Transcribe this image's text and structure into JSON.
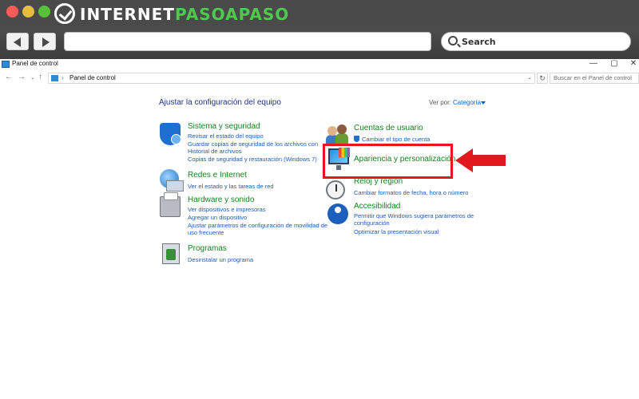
{
  "site": {
    "logo_text": "INTERNET",
    "logo_accent": "PASOAPASO"
  },
  "browser": {
    "search_placeholder": "Search"
  },
  "window": {
    "title": "Panel de control",
    "minimize": "—",
    "maximize": "▢",
    "close": "✕"
  },
  "address": {
    "path": "Panel de control",
    "search_placeholder": "Buscar en el Panel de control"
  },
  "main": {
    "heading": "Ajustar la configuración del equipo",
    "view_by_label": "Ver por:",
    "view_by_value": "Categoría"
  },
  "categories": {
    "system": {
      "title": "Sistema y seguridad",
      "links": [
        "Revisar el estado del equipo",
        "Guardar copias de seguridad de los archivos con",
        "Historial de archivos",
        "Copias de seguridad y restauración (Windows 7)"
      ]
    },
    "network": {
      "title": "Redes e Internet",
      "links": [
        "Ver el estado y las tareas de red"
      ]
    },
    "hardware": {
      "title": "Hardware y sonido",
      "links": [
        "Ver dispositivos e impresoras",
        "Agregar un dispositivo",
        "Ajustar parámetros de configuración de movilidad de",
        "uso frecuente"
      ]
    },
    "programs": {
      "title": "Programas",
      "links": [
        "Desinstalar un programa"
      ]
    },
    "users": {
      "title": "Cuentas de usuario",
      "links": [
        "Cambiar el tipo de cuenta"
      ]
    },
    "appearance": {
      "title": "Apariencia y personalización",
      "links": []
    },
    "clock": {
      "title": "Reloj y región",
      "links": [
        "Cambiar formatos de fecha, hora o número"
      ]
    },
    "accessibility": {
      "title": "Accesibilidad",
      "links": [
        "Permitir que Windows sugiera parámetros de",
        "configuración",
        "Optimizar la presentación visual"
      ]
    }
  },
  "colors": {
    "highlight": "#e3181f",
    "category_title": "#14811d",
    "link": "#1b5cb3",
    "heading": "#1e3287"
  }
}
